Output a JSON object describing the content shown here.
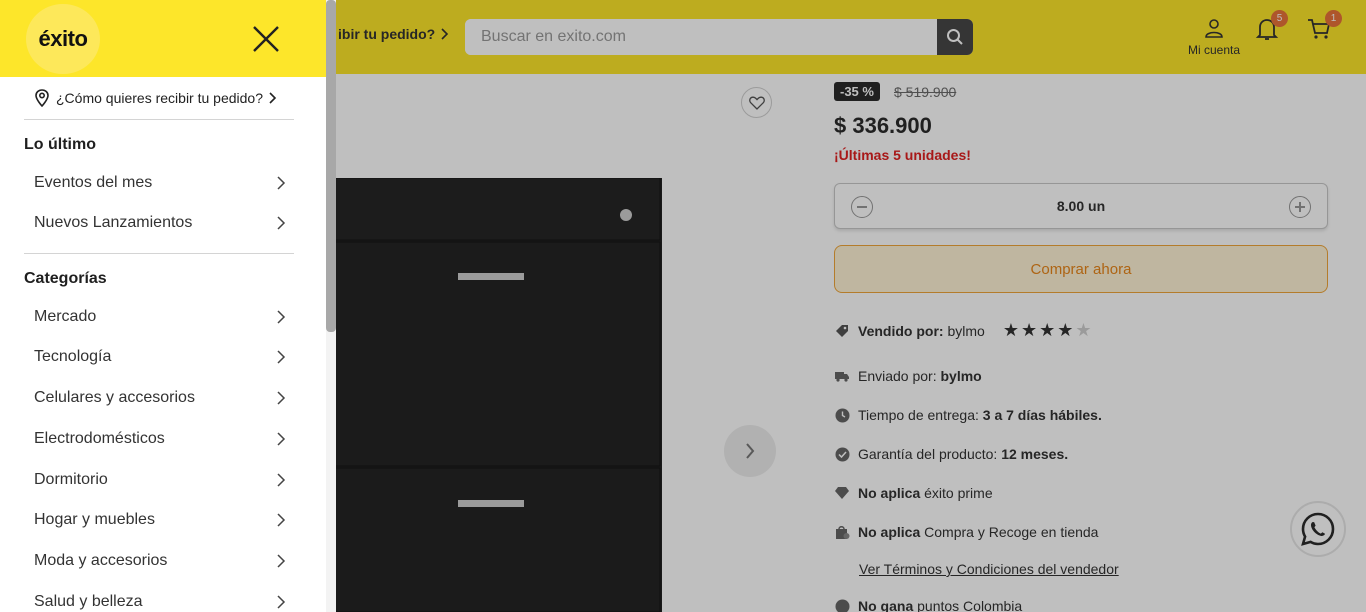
{
  "header": {
    "delivery_text": "ibir tu pedido?",
    "search_placeholder": "Buscar en exito.com",
    "account_label": "Mi cuenta",
    "notification_count": "5",
    "cart_count": "1"
  },
  "product": {
    "discount": "-35 %",
    "old_price": "$ 519.900",
    "price": "$ 336.900",
    "stock_message": "¡Últimas 5 unidades!",
    "quantity": "8.00 un",
    "buy_label": "Comprar ahora",
    "seller_label": "Vendido por:",
    "seller_name": "bylmo",
    "seller_rating": 4,
    "shipped_label": "Enviado por:",
    "shipped_by": "bylmo",
    "delivery_label": "Tiempo de entrega:",
    "delivery_time": "3 a 7 días hábiles.",
    "warranty_label": "Garantía del producto:",
    "warranty_value": "12 meses.",
    "prime_status": "No aplica",
    "prime_label": "éxito prime",
    "pickup_status": "No aplica",
    "pickup_label": "Compra y Recoge en tienda",
    "terms_link": "Ver Términos y Condiciones del vendedor",
    "points_status": "No gana",
    "points_label": "puntos Colombia"
  },
  "drawer": {
    "logo_text": "éxito",
    "delivery_prompt": "¿Cómo quieres recibir tu pedido?",
    "sections": [
      {
        "title": "Lo último",
        "items": [
          "Eventos del mes",
          "Nuevos Lanzamientos"
        ]
      },
      {
        "title": "Categorías",
        "items": [
          "Mercado",
          "Tecnología",
          "Celulares y accesorios",
          "Electrodomésticos",
          "Dormitorio",
          "Hogar y muebles",
          "Moda y accesorios",
          "Salud y belleza"
        ]
      }
    ]
  },
  "colors": {
    "brand_yellow": "#fde62a",
    "alert_red": "#e02020",
    "badge_orange": "#e8733a",
    "buy_orange": "#e8861a"
  }
}
